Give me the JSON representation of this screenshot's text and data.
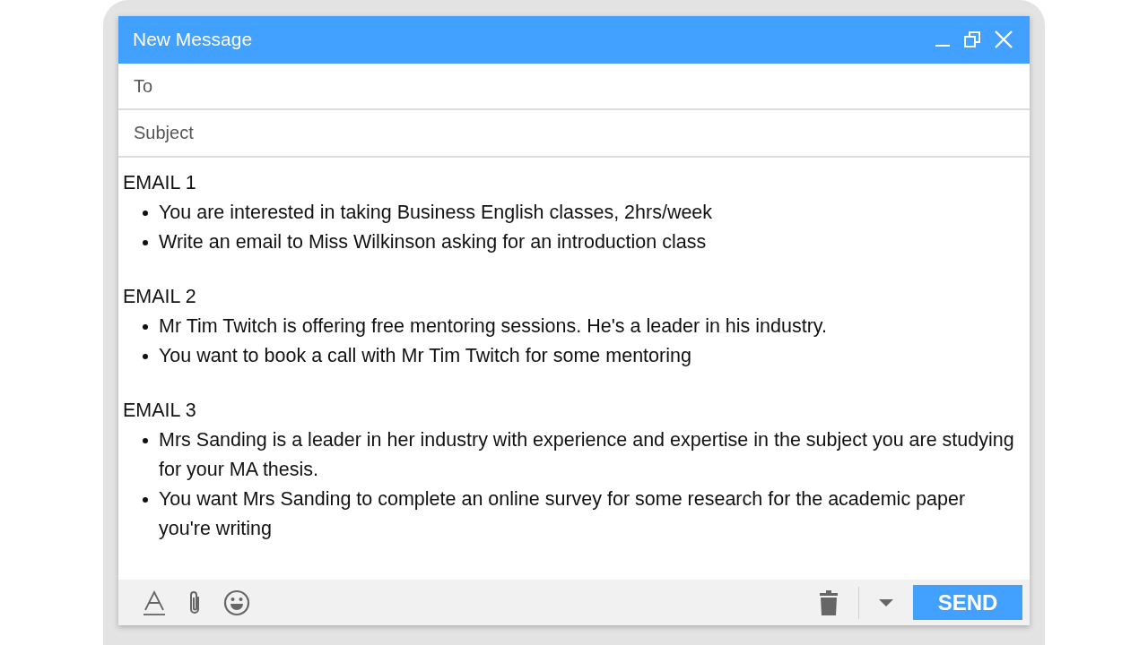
{
  "window": {
    "title": "New Message"
  },
  "to": {
    "placeholder": "To"
  },
  "subject": {
    "placeholder": "Subject"
  },
  "body": [
    {
      "heading": "EMAIL 1",
      "bullets": [
        "You are interested in taking Business English classes, 2hrs/week",
        "Write an email to Miss Wilkinson asking for an introduction class"
      ]
    },
    {
      "heading": "EMAIL 2",
      "bullets": [
        "Mr Tim Twitch is offering free mentoring sessions. He's a leader in his industry.",
        "You want to book a call with Mr Tim Twitch for some mentoring"
      ]
    },
    {
      "heading": "EMAIL 3",
      "bullets": [
        "Mrs Sanding is a leader in her industry with experience and expertise in the subject you are studying for your MA thesis.",
        "You want Mrs Sanding to complete an online survey for some research for the academic paper you're writing"
      ]
    }
  ],
  "send_button": "SEND"
}
